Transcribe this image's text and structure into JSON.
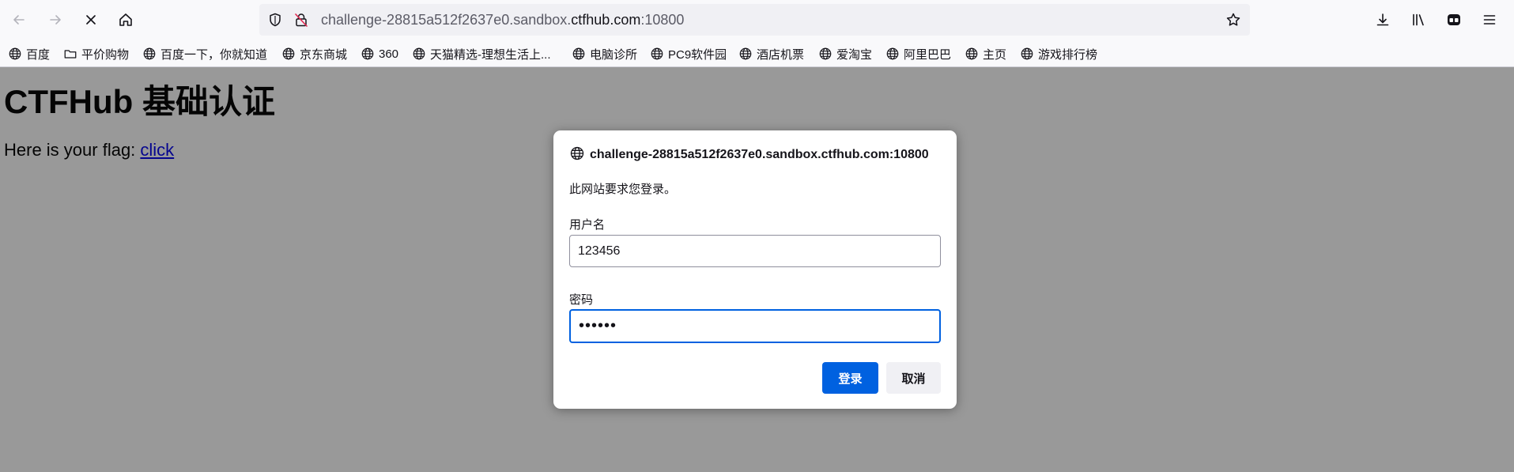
{
  "toolbar": {
    "back_icon": "back-arrow-icon",
    "forward_icon": "forward-arrow-icon",
    "stop_icon": "stop-loading-icon",
    "home_icon": "home-icon",
    "url_prefix": "challenge-28815a512f2637e0.sandbox.",
    "url_domain": "ctfhub.com",
    "url_suffix": ":10800",
    "right_icons": [
      "downloads-icon",
      "library-icon",
      "extension-icon",
      "menu-icon"
    ]
  },
  "bookmarks": [
    {
      "label": "百度",
      "icon": "globe-icon"
    },
    {
      "label": "平价购物",
      "icon": "folder-icon"
    },
    {
      "label": "百度一下，你就知道",
      "icon": "globe-icon"
    },
    {
      "label": "京东商城",
      "icon": "globe-icon"
    },
    {
      "label": "360",
      "icon": "globe-icon"
    },
    {
      "label": "天猫精选-理想生活上...",
      "icon": "globe-icon"
    },
    {
      "label": "电脑诊所",
      "icon": "globe-icon"
    },
    {
      "label": "PC9软件园",
      "icon": "globe-icon"
    },
    {
      "label": "酒店机票",
      "icon": "globe-icon"
    },
    {
      "label": "爱淘宝",
      "icon": "globe-icon"
    },
    {
      "label": "阿里巴巴",
      "icon": "globe-icon"
    },
    {
      "label": "主页",
      "icon": "globe-icon"
    },
    {
      "label": "游戏排行榜",
      "icon": "globe-icon"
    }
  ],
  "page": {
    "title": "CTFHub 基础认证",
    "flag_text": "Here is your flag: ",
    "flag_link": "click"
  },
  "dialog": {
    "host": "challenge-28815a512f2637e0.sandbox.ctfhub.com:10800",
    "message": "此网站要求您登录。",
    "username_label": "用户名",
    "username_value": "123456",
    "password_label": "密码",
    "password_value": "••••••",
    "login_label": "登录",
    "cancel_label": "取消"
  },
  "colors": {
    "accent": "#0061e0",
    "overlay": "#999999",
    "link": "#0000ee"
  }
}
